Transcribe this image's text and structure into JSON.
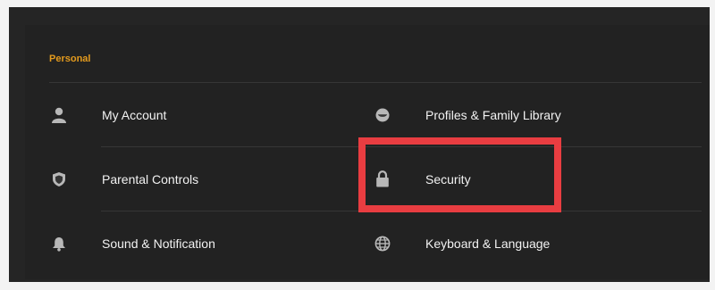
{
  "section": {
    "title": "Personal"
  },
  "items_left": [
    {
      "label": "My Account",
      "icon": "person-icon"
    },
    {
      "label": "Parental Controls",
      "icon": "shield-icon"
    },
    {
      "label": "Sound & Notification",
      "icon": "bell-icon"
    }
  ],
  "items_right": [
    {
      "label": "Profiles & Family Library",
      "icon": "smiley-face-icon"
    },
    {
      "label": "Security",
      "icon": "lock-icon"
    },
    {
      "label": "Keyboard & Language",
      "icon": "globe-icon"
    }
  ],
  "colors": {
    "accent": "#e39a1d",
    "highlight": "#e93d41",
    "text": "#f2f2f2",
    "icon": "#b8b8b8"
  }
}
